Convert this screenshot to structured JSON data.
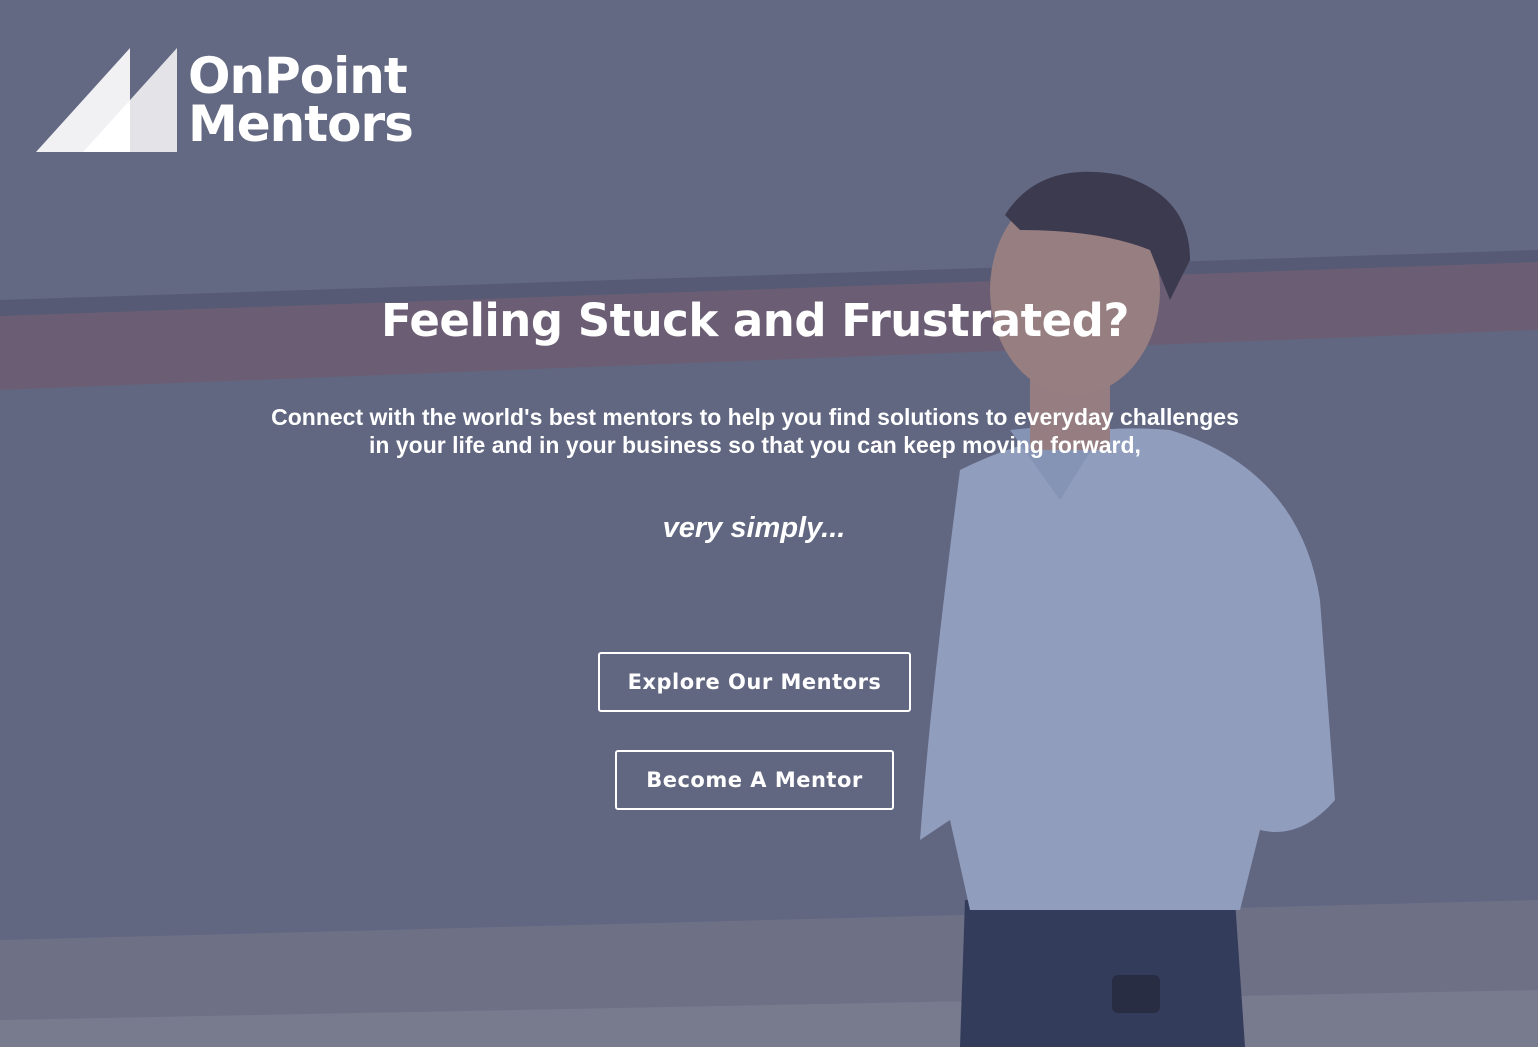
{
  "logo": {
    "line1": "OnPoint",
    "line2": "Mentors",
    "mark_icon": "triangle-sail-logo-icon"
  },
  "hero": {
    "headline": "Feeling Stuck and Frustrated?",
    "subtext": "Connect with the world's best mentors to help you find solutions to everyday challenges in your life and in your business so that you can keep moving forward,",
    "tagline": "very simply..."
  },
  "buttons": {
    "explore": "Explore Our Mentors",
    "become": "Become A Mentor"
  },
  "colors": {
    "overlay": "#464e78",
    "text": "#ffffff",
    "button_border": "#ffffff"
  }
}
